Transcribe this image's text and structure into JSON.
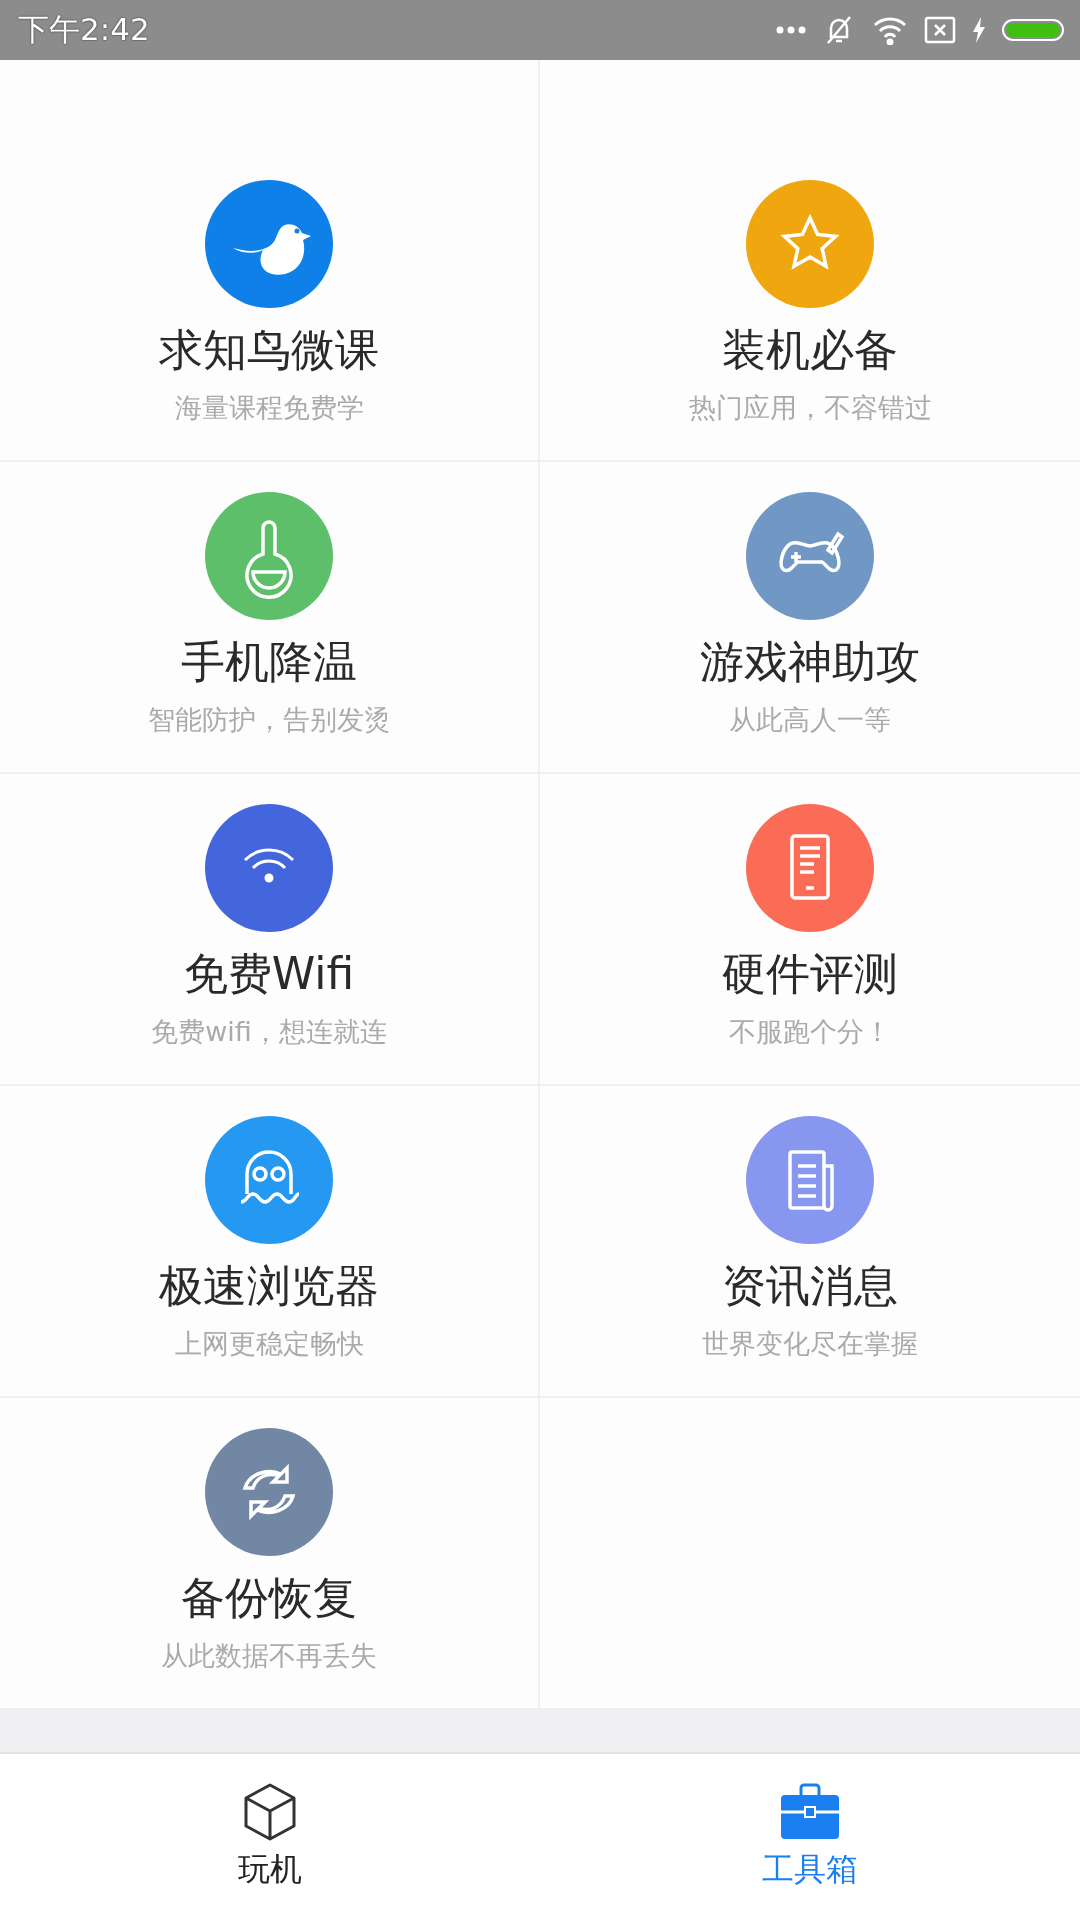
{
  "status_bar": {
    "time": "下午2:42"
  },
  "tools": [
    {
      "kind": "bird",
      "title": "求知鸟微课",
      "subtitle": "海量课程免费学",
      "color": "#0f80e8"
    },
    {
      "kind": "star",
      "title": "装机必备",
      "subtitle": "热门应用，不容错过",
      "color": "#f0a70f"
    },
    {
      "kind": "flask",
      "title": "手机降温",
      "subtitle": "智能防护，告别发烫",
      "color": "#5dbf6a"
    },
    {
      "kind": "gamepad",
      "title": "游戏神助攻",
      "subtitle": "从此高人一等",
      "color": "#7197c4"
    },
    {
      "kind": "wifi",
      "title": "免费Wifi",
      "subtitle": "免费wifi，想连就连",
      "color": "#4466dd"
    },
    {
      "kind": "phone",
      "title": "硬件评测",
      "subtitle": "不服跑个分！",
      "color": "#fb6c56"
    },
    {
      "kind": "octopus",
      "title": "极速浏览器",
      "subtitle": "上网更稳定畅快",
      "color": "#2599f2"
    },
    {
      "kind": "news",
      "title": "资讯消息",
      "subtitle": "世界变化尽在掌握",
      "color": "#8796ef"
    },
    {
      "kind": "sync",
      "title": "备份恢复",
      "subtitle": "从此数据不再丢失",
      "color": "#7287a3"
    }
  ],
  "tabs": [
    {
      "kind": "cube",
      "label": "玩机",
      "selected": false
    },
    {
      "kind": "toolbox",
      "label": "工具箱",
      "selected": true
    }
  ]
}
